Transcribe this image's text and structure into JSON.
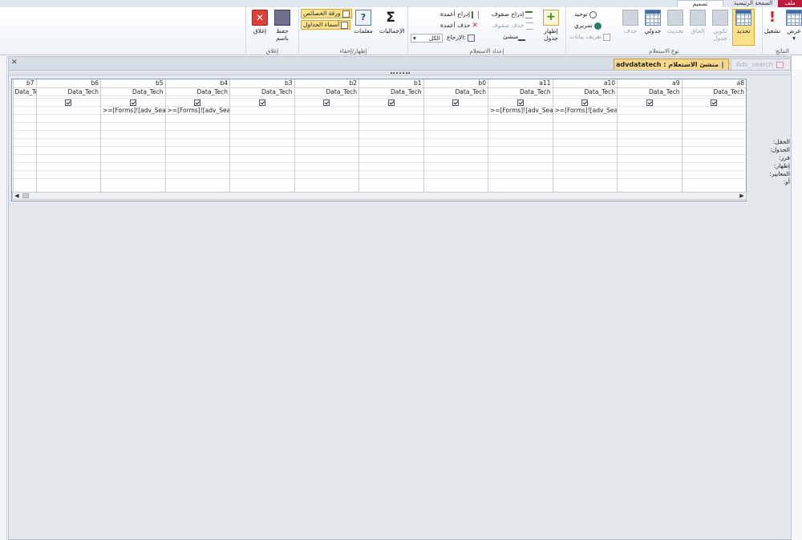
{
  "tabs": {
    "file": "ملف",
    "home": "الصفحة الرئيسية",
    "design": "تصميم"
  },
  "ribbon": {
    "results": {
      "label": "النتائج",
      "view": "عرض",
      "run": "تشغيل"
    },
    "query_type": {
      "label": "نوع الاستعلام",
      "select": "تحديد",
      "make_table": "تكوين جدول",
      "append": "إلحاق",
      "update": "تحديث",
      "crosstab": "جدولي",
      "delete": "حذف",
      "union": "توحيد",
      "pass_through": "تمريري",
      "data_definition": "تعريف بيانات"
    },
    "query_setup": {
      "label": "إعداد الاستعلام",
      "show_table": "إظهار جدول",
      "insert_rows": "إدراج صفوف",
      "delete_rows": "حذف صفوف",
      "builder": "منشئ",
      "insert_columns": "إدراج أعمدة",
      "delete_columns": "حذف أعمدة",
      "return_label": "الإرجاع:",
      "return_value": "الكل"
    },
    "show_hide": {
      "label": "إظهار/إخفاء",
      "totals": "الإجماليات",
      "parameters": "معلمات",
      "property_sheet": "ورقة الخصائص",
      "table_names": "أسماء الجداول"
    },
    "close": {
      "label": "إغلاق",
      "save_as": "حفظ باسم",
      "close": "إغلاق"
    }
  },
  "document": {
    "active_tab": "advdatatech : منشئ الاستعلام",
    "inactive_tab": "Adv_search"
  },
  "grid": {
    "row_labels": [
      "الحقل:",
      "الجدول:",
      "فرز:",
      "إظهار:",
      "المعايير:",
      "أو:"
    ],
    "columns": [
      {
        "field": "a8",
        "table": "Data_Tech",
        "show": true,
        "criteria": ""
      },
      {
        "field": "a9",
        "table": "Data_Tech",
        "show": true,
        "criteria": ""
      },
      {
        "field": "a10",
        "table": "Data_Tech",
        "show": true,
        "criteria": ">=[Forms]![adv_Search"
      },
      {
        "field": "a11",
        "table": "Data_Tech",
        "show": true,
        "criteria": ">=[Forms]![adv_Search"
      },
      {
        "field": "b0",
        "table": "Data_Tech",
        "show": true,
        "criteria": ""
      },
      {
        "field": "b1",
        "table": "Data_Tech",
        "show": true,
        "criteria": ""
      },
      {
        "field": "b2",
        "table": "Data_Tech",
        "show": true,
        "criteria": ""
      },
      {
        "field": "b3",
        "table": "Data_Tech",
        "show": true,
        "criteria": ""
      },
      {
        "field": "b4",
        "table": "Data_Tech",
        "show": true,
        "criteria": ">=[Forms]![adv_Search"
      },
      {
        "field": "b5",
        "table": "Data_Tech",
        "show": true,
        "criteria": ">=[Forms]![adv_Search"
      },
      {
        "field": "b6",
        "table": "Data_Tech",
        "show": true,
        "criteria": ""
      },
      {
        "field": "b7",
        "table": "Data_Tech",
        "show": false,
        "criteria": ""
      }
    ]
  }
}
